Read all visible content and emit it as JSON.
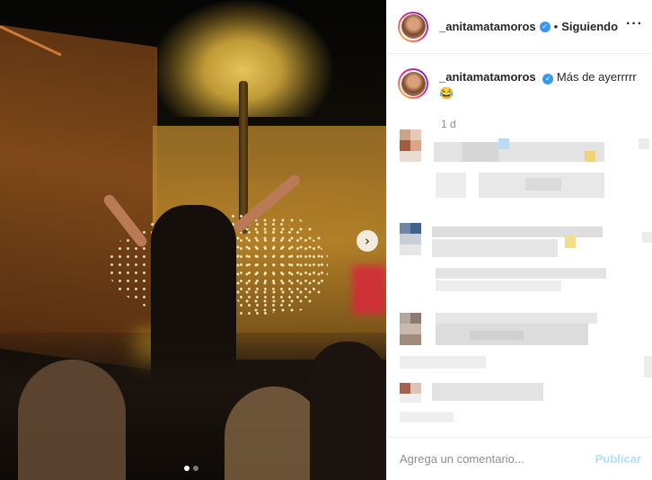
{
  "post": {
    "media": {
      "next_icon": "chevron-right-icon",
      "next_glyph": "›",
      "carousel": {
        "count": 2,
        "active_index": 0
      }
    },
    "header": {
      "username": "_anitamatamoros",
      "separator": "•",
      "follow_status": "Siguiendo",
      "more_glyph": "···",
      "verified_glyph": "✓"
    },
    "caption": {
      "username": "_anitamatamoros",
      "text": "Más de ayerrrrr",
      "emoji": "😂",
      "time": "1 d"
    },
    "add_comment": {
      "placeholder": "Agrega un comentario...",
      "publish_label": "Publicar"
    },
    "colors": {
      "verified": "#3897f0",
      "publish_disabled": "#b2dffc",
      "meta_text": "#8e8e8e"
    }
  }
}
